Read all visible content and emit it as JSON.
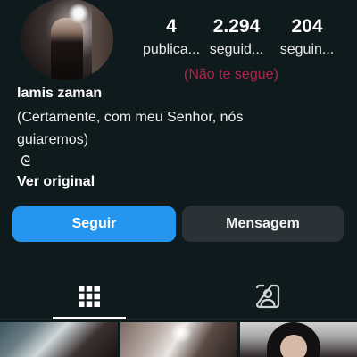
{
  "profile": {
    "name": "lamis zaman",
    "bio_line": "(Certamente, com meu Senhor, nós guiaremos)",
    "bio_emoji": "ᘓ",
    "see_original": "Ver original",
    "not_following_you": "(Não te segue)"
  },
  "stats": {
    "posts": {
      "value": "4",
      "label": "publica..."
    },
    "followers": {
      "value": "2.294",
      "label": "seguid..."
    },
    "following": {
      "value": "204",
      "label": "seguin..."
    }
  },
  "actions": {
    "follow_label": "Seguir",
    "message_label": "Mensagem"
  },
  "tabs": [
    {
      "icon": "grid-icon",
      "active": true
    },
    {
      "icon": "tagged-person-icon",
      "active": false
    }
  ],
  "colors": {
    "background": "#0f1a1d",
    "follow_button": "#2496f0",
    "message_button": "#2a3236",
    "not_following_text": "#b3224a"
  }
}
